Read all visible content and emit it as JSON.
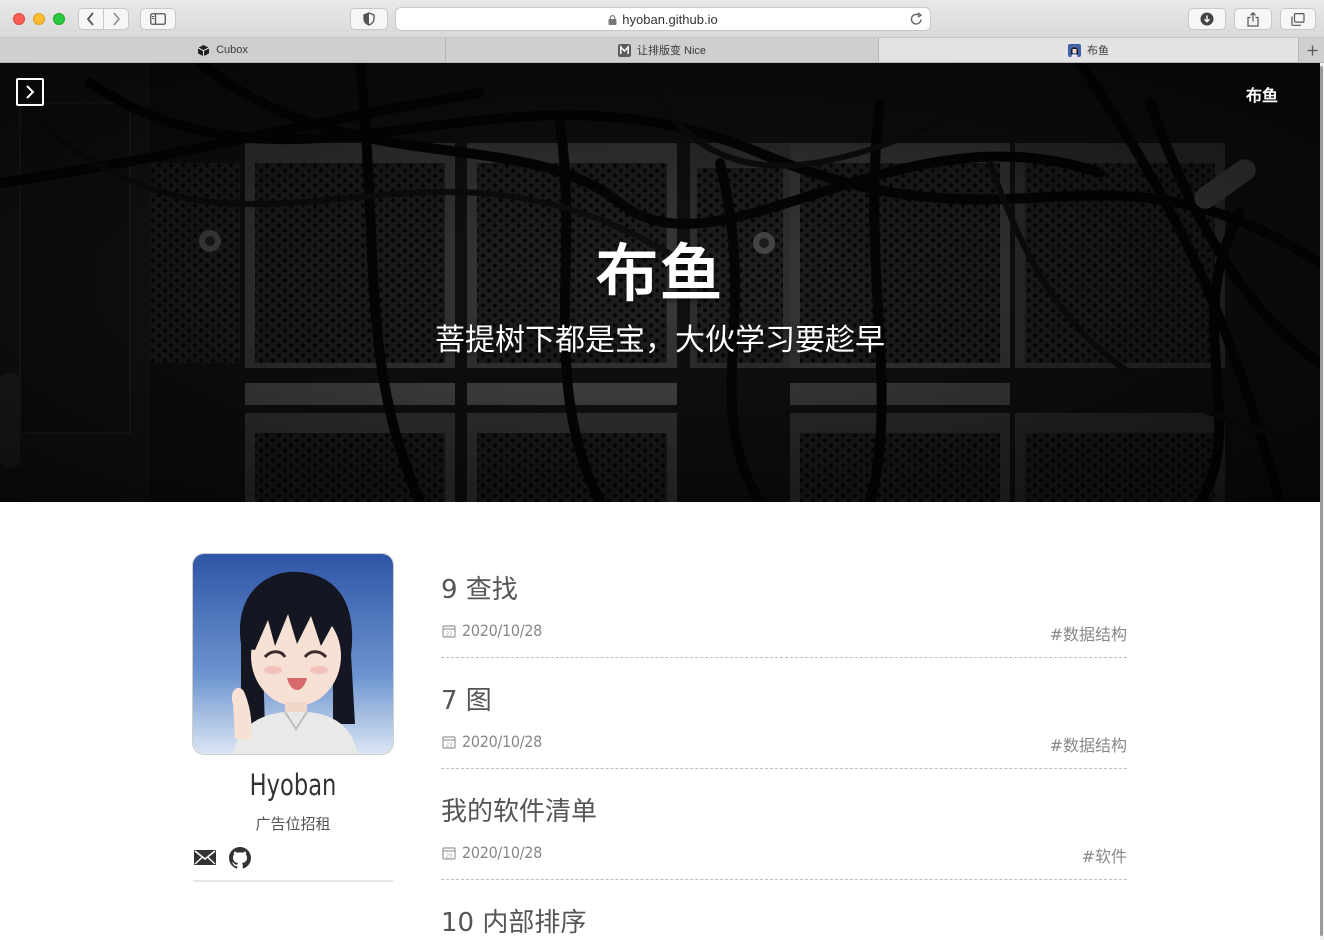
{
  "browser": {
    "url": "hyoban.github.io",
    "tabs": [
      {
        "label": "Cubox",
        "icon": "cubox-icon"
      },
      {
        "label": "让排版变 Nice",
        "icon": "mdnice-icon"
      },
      {
        "label": "布鱼",
        "icon": "avatar-favicon-icon"
      }
    ],
    "active_tab": 2
  },
  "hero": {
    "title": "布鱼",
    "subtitle": "菩提树下都是宝，大伙学习要趁早",
    "site_link": "布鱼"
  },
  "profile": {
    "name": "Hyoban",
    "description": "广告位招租",
    "icons": [
      "mail-icon",
      "github-icon"
    ]
  },
  "posts": [
    {
      "title": "9 查找",
      "date": "2020/10/28",
      "tag": "#数据结构"
    },
    {
      "title": "7 图",
      "date": "2020/10/28",
      "tag": "#数据结构"
    },
    {
      "title": "我的软件清单",
      "date": "2020/10/28",
      "tag": "#软件"
    },
    {
      "title": "10 内部排序",
      "date": "",
      "tag": ""
    }
  ],
  "colors": {
    "hero_overlay": "#1c1c1c",
    "text_primary": "#555555",
    "text_meta": "#888888",
    "divider": "#bdbdbd"
  }
}
